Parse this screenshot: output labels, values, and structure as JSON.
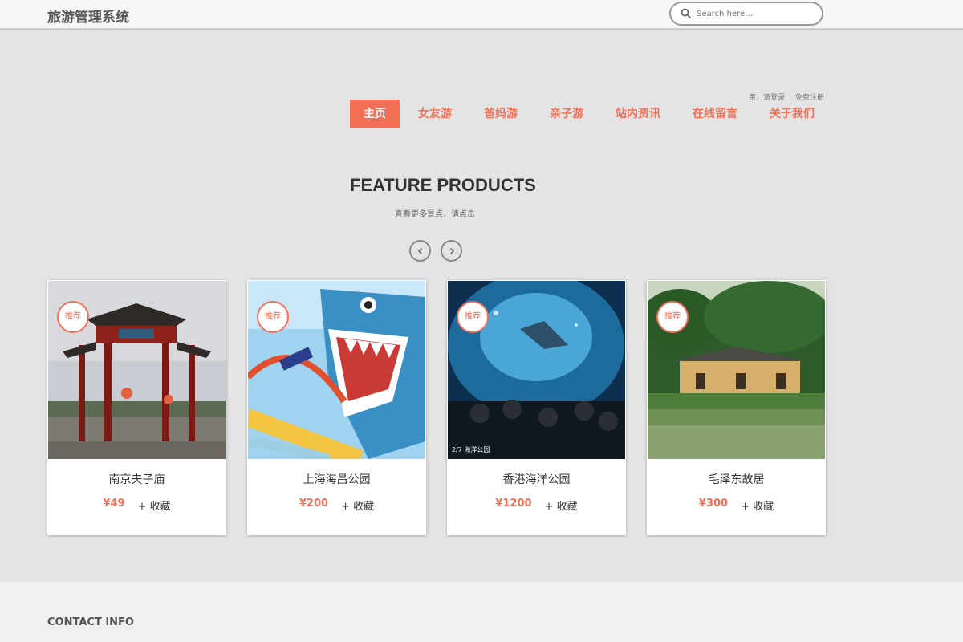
{
  "header": {
    "brand": "旅游管理系统",
    "search_placeholder": "Search here…"
  },
  "auth": {
    "login": "亲，请登录",
    "register": "免费注册"
  },
  "nav": {
    "items": [
      "主页",
      "女友游",
      "爸妈游",
      "亲子游",
      "站内资讯",
      "在线留言",
      "关于我们"
    ],
    "active_index": 0
  },
  "section": {
    "title": "FEATURE PRODUCTS",
    "subtitle": "查看更多景点，请点击"
  },
  "carousel": {
    "prev_icon": "chevron-left-icon",
    "next_icon": "chevron-right-icon"
  },
  "products": [
    {
      "badge": "推荐",
      "name": "南京夫子庙",
      "price": "¥49",
      "fav": "+ 收藏"
    },
    {
      "badge": "推荐",
      "name": "上海海昌公园",
      "price": "¥200",
      "fav": "+ 收藏"
    },
    {
      "badge": "推荐",
      "name": "香港海洋公园",
      "price": "¥1200",
      "fav": "+ 收藏",
      "caption": "2/7 海洋公园"
    },
    {
      "badge": "推荐",
      "name": "毛泽东故居",
      "price": "¥300",
      "fav": "+ 收藏"
    }
  ],
  "footer": {
    "contact_title": "CONTACT INFO"
  },
  "colors": {
    "accent": "#f37056",
    "background": "#e4e4e4"
  }
}
